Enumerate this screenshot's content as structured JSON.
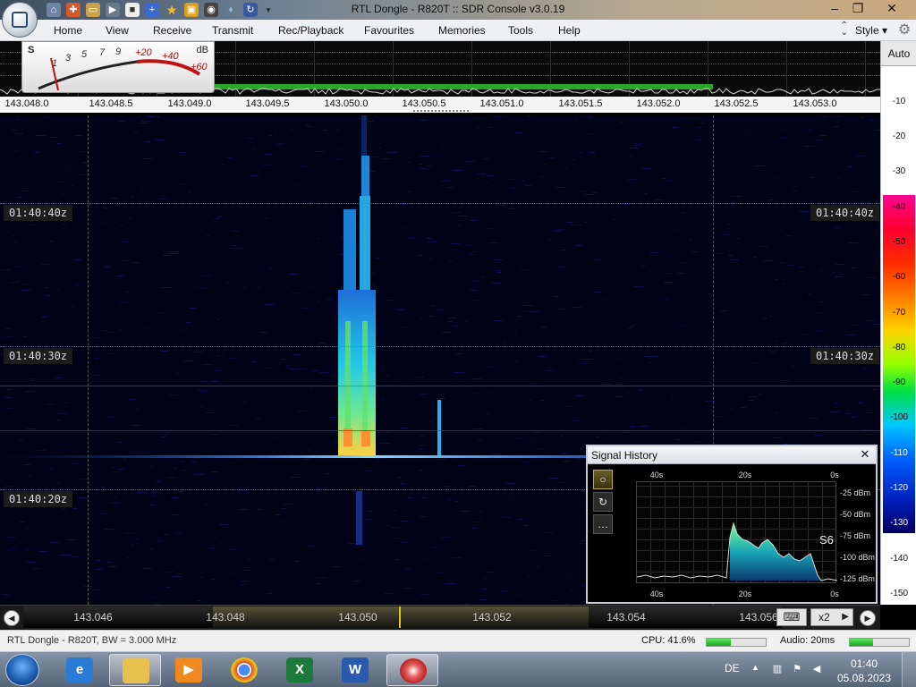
{
  "window": {
    "title": "RTL Dongle - R820T :: SDR Console v3.0.19"
  },
  "menu": {
    "items": [
      "Home",
      "View",
      "Receive",
      "Transmit",
      "Rec/Playback",
      "Favourites",
      "Memories",
      "Tools",
      "Help"
    ],
    "style_label": "Style"
  },
  "smeter": {
    "s_label": "S",
    "db_label": "dB",
    "ticks": [
      "1",
      "3",
      "5",
      "7",
      "9",
      "+20",
      "+40",
      "+60"
    ]
  },
  "spectrum": {
    "freq_labels": [
      "143.048.0",
      "143.048.5",
      "143.049.0",
      "143.049.5",
      "143.050.0",
      "143.050.5",
      "143.051.0",
      "143.051.5",
      "143.052.0",
      "143.052.5",
      "143.053.0"
    ]
  },
  "level_scale": {
    "auto_label": "Auto",
    "labels": [
      "-10",
      "-20",
      "-30",
      "-40",
      "-50",
      "-60",
      "-70",
      "-80",
      "-90",
      "-100",
      "-110",
      "-120",
      "-130",
      "-140",
      "-150"
    ]
  },
  "waterfall": {
    "time_labels": [
      "01:40:40z",
      "01:40:30z",
      "01:40:20z"
    ]
  },
  "signal_history": {
    "title": "Signal History",
    "close_glyph": "✕",
    "x_labels": [
      "40s",
      "20s",
      "0s"
    ],
    "y_labels": [
      "-25 dBm",
      "-50 dBm",
      "-75 dBm",
      "-100 dBm",
      "-125 dBm"
    ],
    "s_reading": "S6",
    "buttons": [
      "○",
      "↻",
      "…"
    ]
  },
  "tuning": {
    "labels": [
      "143.046",
      "143.048",
      "143.050",
      "143.052",
      "143.054",
      "143.056"
    ],
    "zoom_label": "x2",
    "keyboard_glyph": "⌨"
  },
  "status": {
    "device": "RTL Dongle - R820T, BW = 3.000 MHz",
    "cpu": "CPU: 41.6%",
    "cpu_value": 0.416,
    "audio": "Audio: 20ms",
    "audio_level": 0.4
  },
  "taskbar": {
    "language": "DE",
    "time": "01:40",
    "date": "05.08.2023",
    "apps": [
      "internet-explorer",
      "file-explorer",
      "media-player",
      "chrome",
      "excel",
      "word",
      "sdr-console"
    ]
  }
}
